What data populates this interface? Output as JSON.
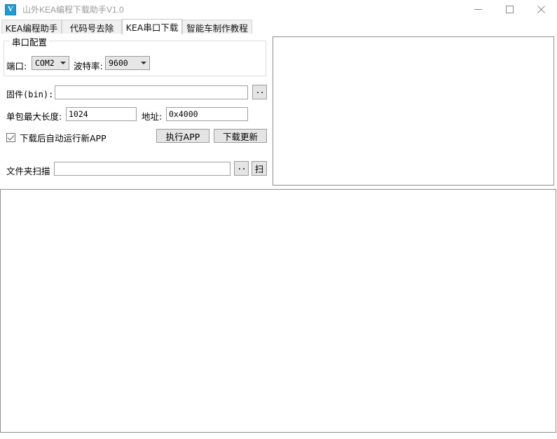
{
  "window": {
    "title": "山外KEA编程下载助手V1.0",
    "icon_name": "app-logo-v-icon",
    "icon_letter": "V",
    "controls": {
      "minimize": "minimize-icon",
      "maximize": "maximize-icon",
      "close": "close-icon"
    }
  },
  "tabs": [
    {
      "label": "KEA编程助手",
      "active": false
    },
    {
      "label": "代码号去除",
      "active": false
    },
    {
      "label": "KEA串口下载",
      "active": true
    },
    {
      "label": "智能车制作教程",
      "active": false
    }
  ],
  "serial_config": {
    "group_title": "串口配置",
    "port_label": "端口:",
    "port_value": "COM2",
    "baud_label": "波特率:",
    "baud_value": "9600"
  },
  "firmware": {
    "label": "固件(bin):",
    "value": "",
    "placeholder": "",
    "browse_button": ".."
  },
  "packet": {
    "length_label": "单包最大长度:",
    "length_value": "1024",
    "address_label": "地址:",
    "address_value": "0x4000"
  },
  "options": {
    "auto_run_label": "下载后自动运行新APP",
    "auto_run_checked": true
  },
  "actions": {
    "run_app": "执行APP",
    "download_update": "下载更新"
  },
  "folder_scan": {
    "label": "文件夹扫描",
    "value": "",
    "placeholder": "",
    "browse_button": "..",
    "scan_button": "扫"
  },
  "log": {
    "right_panel_text": "",
    "bottom_panel_text": ""
  },
  "colors": {
    "accent": "#1e9ad6",
    "titlebar_text": "#9b9b9b",
    "tab_inactive_bg": "#f0f0f0",
    "button_bg": "#e4e4e4",
    "panel_border": "#8f8f8f"
  }
}
